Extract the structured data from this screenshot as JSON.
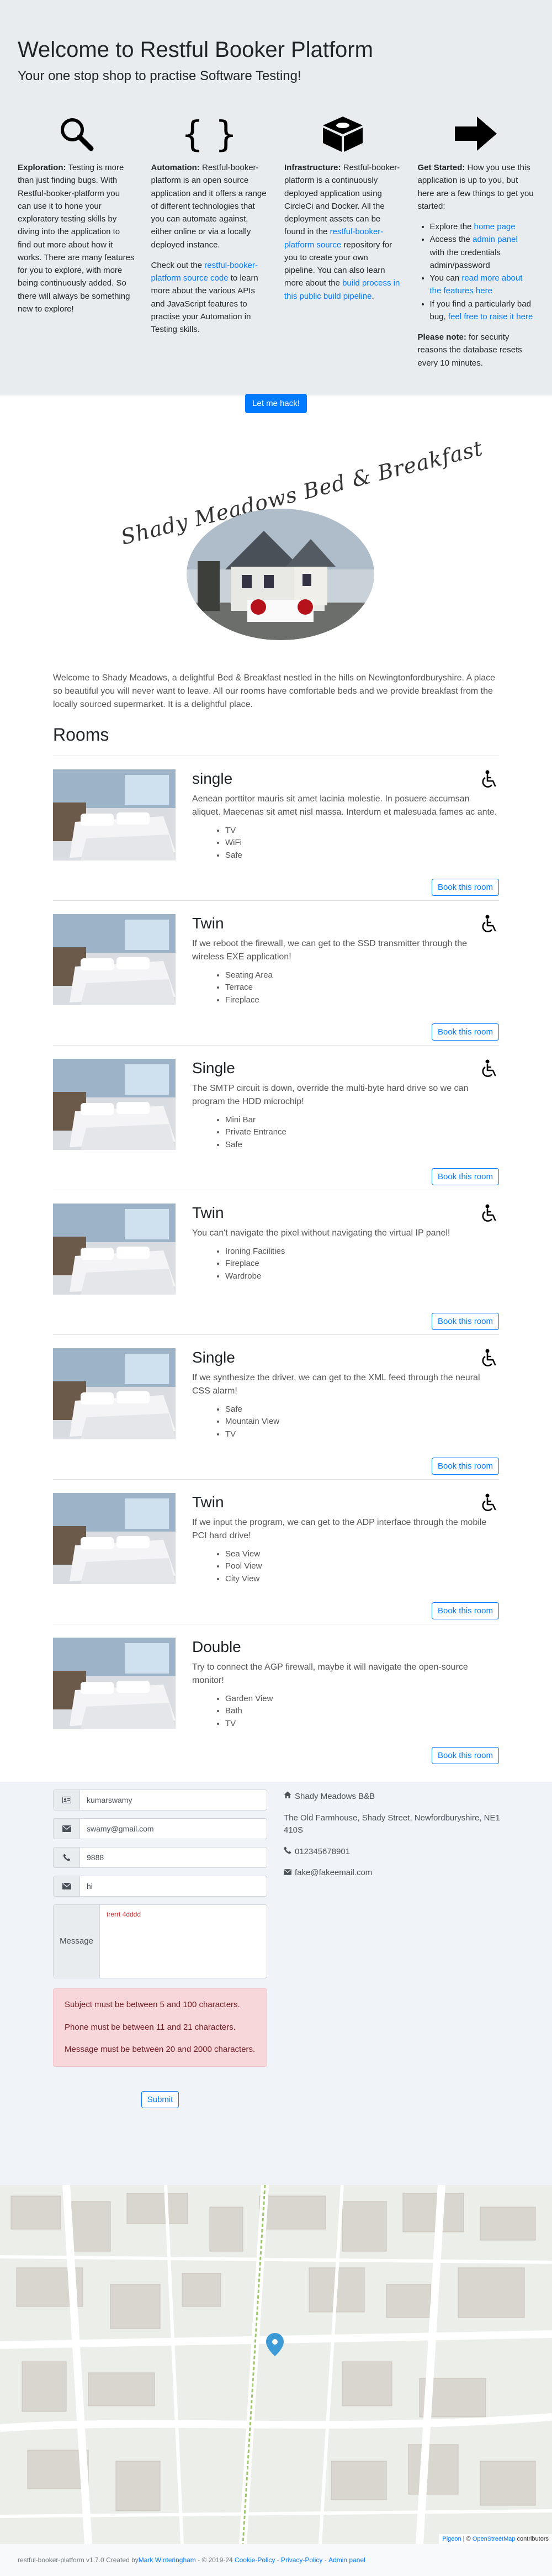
{
  "hero": {
    "title": "Welcome to Restful Booker Platform",
    "subtitle": "Your one stop shop to practise Software Testing!",
    "cols": [
      {
        "lead": "Exploration:",
        "text": "Testing is more than just finding bugs. With Restful-booker-platform you can use it to hone your exploratory testing skills by diving into the application to find out more about how it works. There are many features for you to explore, with more being continuously added. So there will always be something new to explore!"
      },
      {
        "lead": "Automation:",
        "text": "Restful-booker-platform is an open source application and it offers a range of different technologies that you can automate against, either online or via a locally deployed instance.",
        "text2_pre": "Check out the ",
        "text2_link": "restful-booker-platform source code",
        "text2_post": " to learn more about the various APIs and JavaScript features to practise your Automation in Testing skills."
      },
      {
        "lead": "Infrastructure:",
        "text_pre": "Restful-booker-platform is a continuously deployed application using CircleCi and Docker. All the deployment assets can be found in the ",
        "link1": "restful-booker-platform source",
        "text_mid": " repository for you to create your own pipeline. You can also learn more about the ",
        "link2": "build process in this public build pipeline",
        "text_post": "."
      },
      {
        "lead": "Get Started:",
        "text": "How you use this application is up to you, but here are a few things to get you started:",
        "li1_pre": "Explore the ",
        "li1_link": "home page",
        "li2_pre": "Access the ",
        "li2_link": "admin panel",
        "li2_post": " with the credentials admin/password",
        "li3_pre": "You can ",
        "li3_link": "read more about the features here",
        "li4_pre": "If you find a particularly bad bug, ",
        "li4_link": "feel free to raise it here",
        "note_lead": "Please note:",
        "note": "for security reasons the database resets every 10 minutes."
      }
    ],
    "hack_button": "Let me hack!"
  },
  "hotel": {
    "logo_text": "Shady Meadows Bed & Breakfast",
    "description": "Welcome to Shady Meadows, a delightful Bed & Breakfast nestled in the hills on Newingtonfordburyshire. A place so beautiful you will never want to leave. All our rooms have comfortable beds and we provide breakfast from the locally sourced supermarket. It is a delightful place."
  },
  "rooms_title": "Rooms",
  "book_label": "Book this room",
  "rooms": [
    {
      "name": "single",
      "desc": "Aenean porttitor mauris sit amet lacinia molestie. In posuere accumsan aliquet. Maecenas sit amet nisl massa. Interdum et malesuada fames ac ante.",
      "features": [
        "TV",
        "WiFi",
        "Safe"
      ],
      "accessible": true
    },
    {
      "name": "Twin",
      "desc": "If we reboot the firewall, we can get to the SSD transmitter through the wireless EXE application!",
      "features": [
        "Seating Area",
        "Terrace",
        "Fireplace"
      ],
      "accessible": true
    },
    {
      "name": "Single",
      "desc": "The SMTP circuit is down, override the multi-byte hard drive so we can program the HDD microchip!",
      "features": [
        "Mini Bar",
        "Private Entrance",
        "Safe"
      ],
      "accessible": true
    },
    {
      "name": "Twin",
      "desc": "You can't navigate the pixel without navigating the virtual IP panel!",
      "features": [
        "Ironing Facilities",
        "Fireplace",
        "Wardrobe"
      ],
      "accessible": true
    },
    {
      "name": "Single",
      "desc": "If we synthesize the driver, we can get to the XML feed through the neural CSS alarm!",
      "features": [
        "Safe",
        "Mountain View",
        "TV"
      ],
      "accessible": true
    },
    {
      "name": "Twin",
      "desc": "If we input the program, we can get to the ADP interface through the mobile PCI hard drive!",
      "features": [
        "Sea View",
        "Pool View",
        "City View"
      ],
      "accessible": true
    },
    {
      "name": "Double",
      "desc": "Try to connect the AGP firewall, maybe it will navigate the open-source monitor!",
      "features": [
        "Garden View",
        "Bath",
        "TV"
      ],
      "accessible": false
    }
  ],
  "form": {
    "name_value": "kumarswamy",
    "email_value": "swamy@gmail.com",
    "phone_value": "9888",
    "subject_value": "hi",
    "message_label": "Message",
    "message_value": "trerrt 4dddd",
    "errors": [
      "Subject must be between 5 and 100 characters.",
      "Phone must be between 11 and 21 characters.",
      "Message must be between 20 and 2000 characters."
    ],
    "submit": "Submit"
  },
  "address": {
    "name": "Shady Meadows B&B",
    "line": "The Old Farmhouse, Shady Street, Newfordburyshire, NE1 410S",
    "phone": "012345678901",
    "email": "fake@fakeemail.com"
  },
  "map": {
    "attrib_link": "Pigeon",
    "attrib_sep": " | © ",
    "attrib_osm": "OpenStreetMap",
    "attrib_post": " contributors"
  },
  "footer": {
    "pre": "restful-booker-platform v1.7.0 Created by ",
    "author": "Mark Winteringham",
    "years": " - © 2019-24 ",
    "cookie": "Cookie-Policy",
    "sep1": " - ",
    "privacy": "Privacy-Policy",
    "sep2": " - ",
    "admin": "Admin panel"
  },
  "colors": {
    "primary": "#007bff",
    "hero_bg": "#e9ecef",
    "alert_bg": "#f8d7da"
  }
}
